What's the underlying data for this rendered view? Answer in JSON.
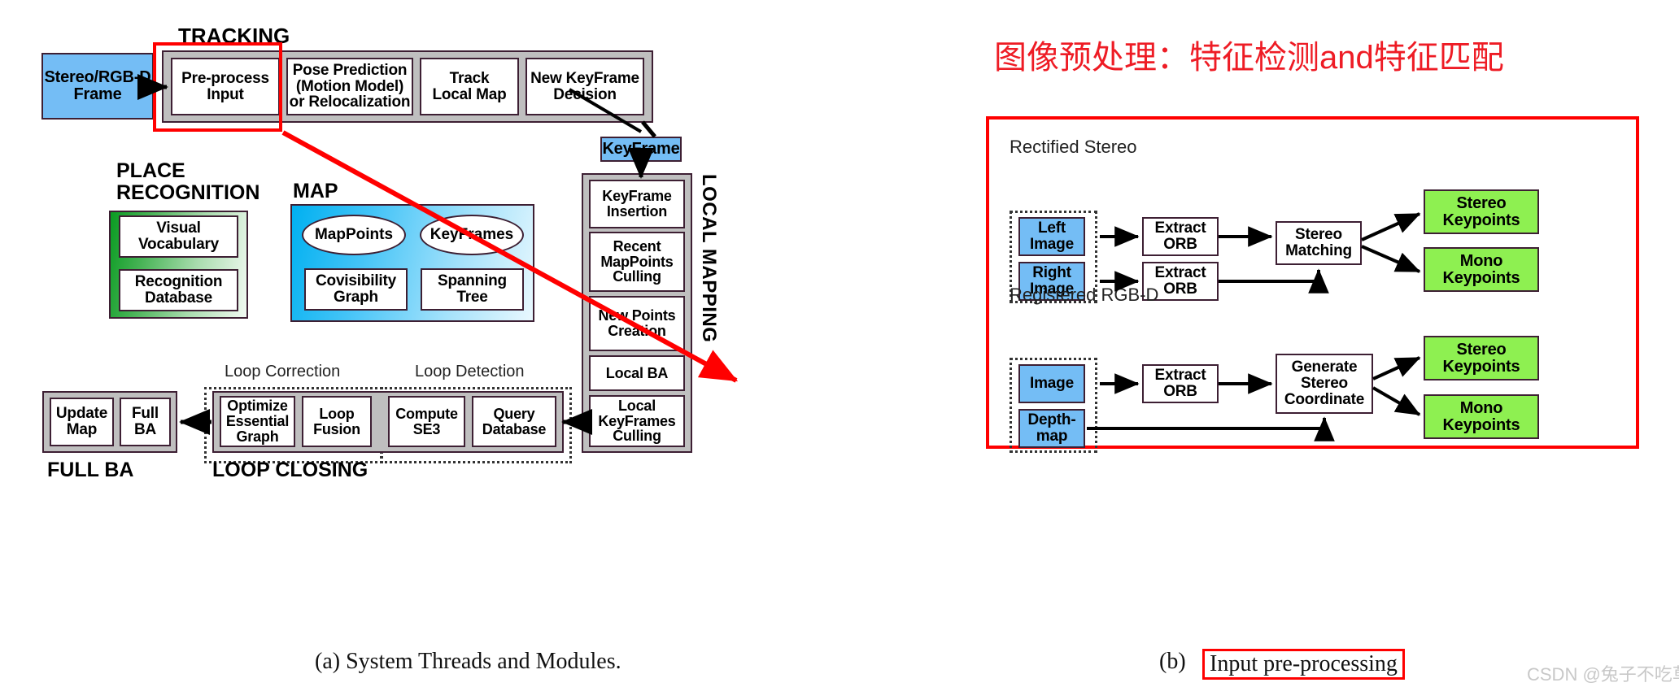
{
  "figure": {
    "caption_a": "(a) System Threads and Modules.",
    "caption_b_prefix": "(b)",
    "caption_b_boxed": "Input pre-processing",
    "watermark": "CSDN @兔子不吃草~",
    "annotation_title": "图像预处理：特征检测and特征匹配",
    "accent_red": "#ff0000",
    "title_red": "#ee1c25",
    "blue_fill": "#74bdf5",
    "green_fill": "#8ef051",
    "gray_thread": "#bfbfbf",
    "outline": "#3d1f33"
  },
  "panel_a": {
    "tracking": {
      "title": "TRACKING",
      "input_node": "Stereo/RGB-D\nFrame",
      "stages": [
        "Pre-process\nInput",
        "Pose Prediction\n(Motion Model)\nor Relocalization",
        "Track\nLocal Map",
        "New KeyFrame\nDecision"
      ]
    },
    "place_recognition": {
      "title": "PLACE\nRECOGNITION",
      "items": [
        "Visual\nVocabulary",
        "Recognition\nDatabase"
      ]
    },
    "map": {
      "title": "MAP",
      "ellipses": [
        "MapPoints",
        "KeyFrames"
      ],
      "boxes": [
        "Covisibility\nGraph",
        "Spanning\nTree"
      ]
    },
    "local_mapping": {
      "title": "LOCAL MAPPING",
      "keyframe_node": "KeyFrame",
      "stages": [
        "KeyFrame\nInsertion",
        "Recent\nMapPoints\nCulling",
        "New Points\nCreation",
        "Local BA",
        "Local\nKeyFrames\nCulling"
      ]
    },
    "full_ba": {
      "title": "FULL BA",
      "items": [
        "Update\nMap",
        "Full\nBA"
      ]
    },
    "loop_closing": {
      "title": "LOOP CLOSING",
      "group_labels": [
        "Loop Correction",
        "Loop Detection"
      ],
      "correction_items": [
        "Optimize\nEssential\nGraph",
        "Loop\nFusion"
      ],
      "detection_items": [
        "Compute\nSE3",
        "Query\nDatabase"
      ]
    }
  },
  "panel_b": {
    "rectified_stereo": {
      "label": "Rectified Stereo",
      "inputs": [
        "Left\nImage",
        "Right\nImage"
      ],
      "extract": [
        "Extract\nORB",
        "Extract\nORB"
      ],
      "match": "Stereo\nMatching",
      "outputs": [
        "Stereo\nKeypoints",
        "Mono\nKeypoints"
      ]
    },
    "registered_rgbd": {
      "label": "Registered RGB-D",
      "inputs": [
        "Image",
        "Depth-\nmap"
      ],
      "extract": "Extract\nORB",
      "generate": "Generate\nStereo\nCoordinate",
      "outputs": [
        "Stereo\nKeypoints",
        "Mono\nKeypoints"
      ]
    }
  }
}
